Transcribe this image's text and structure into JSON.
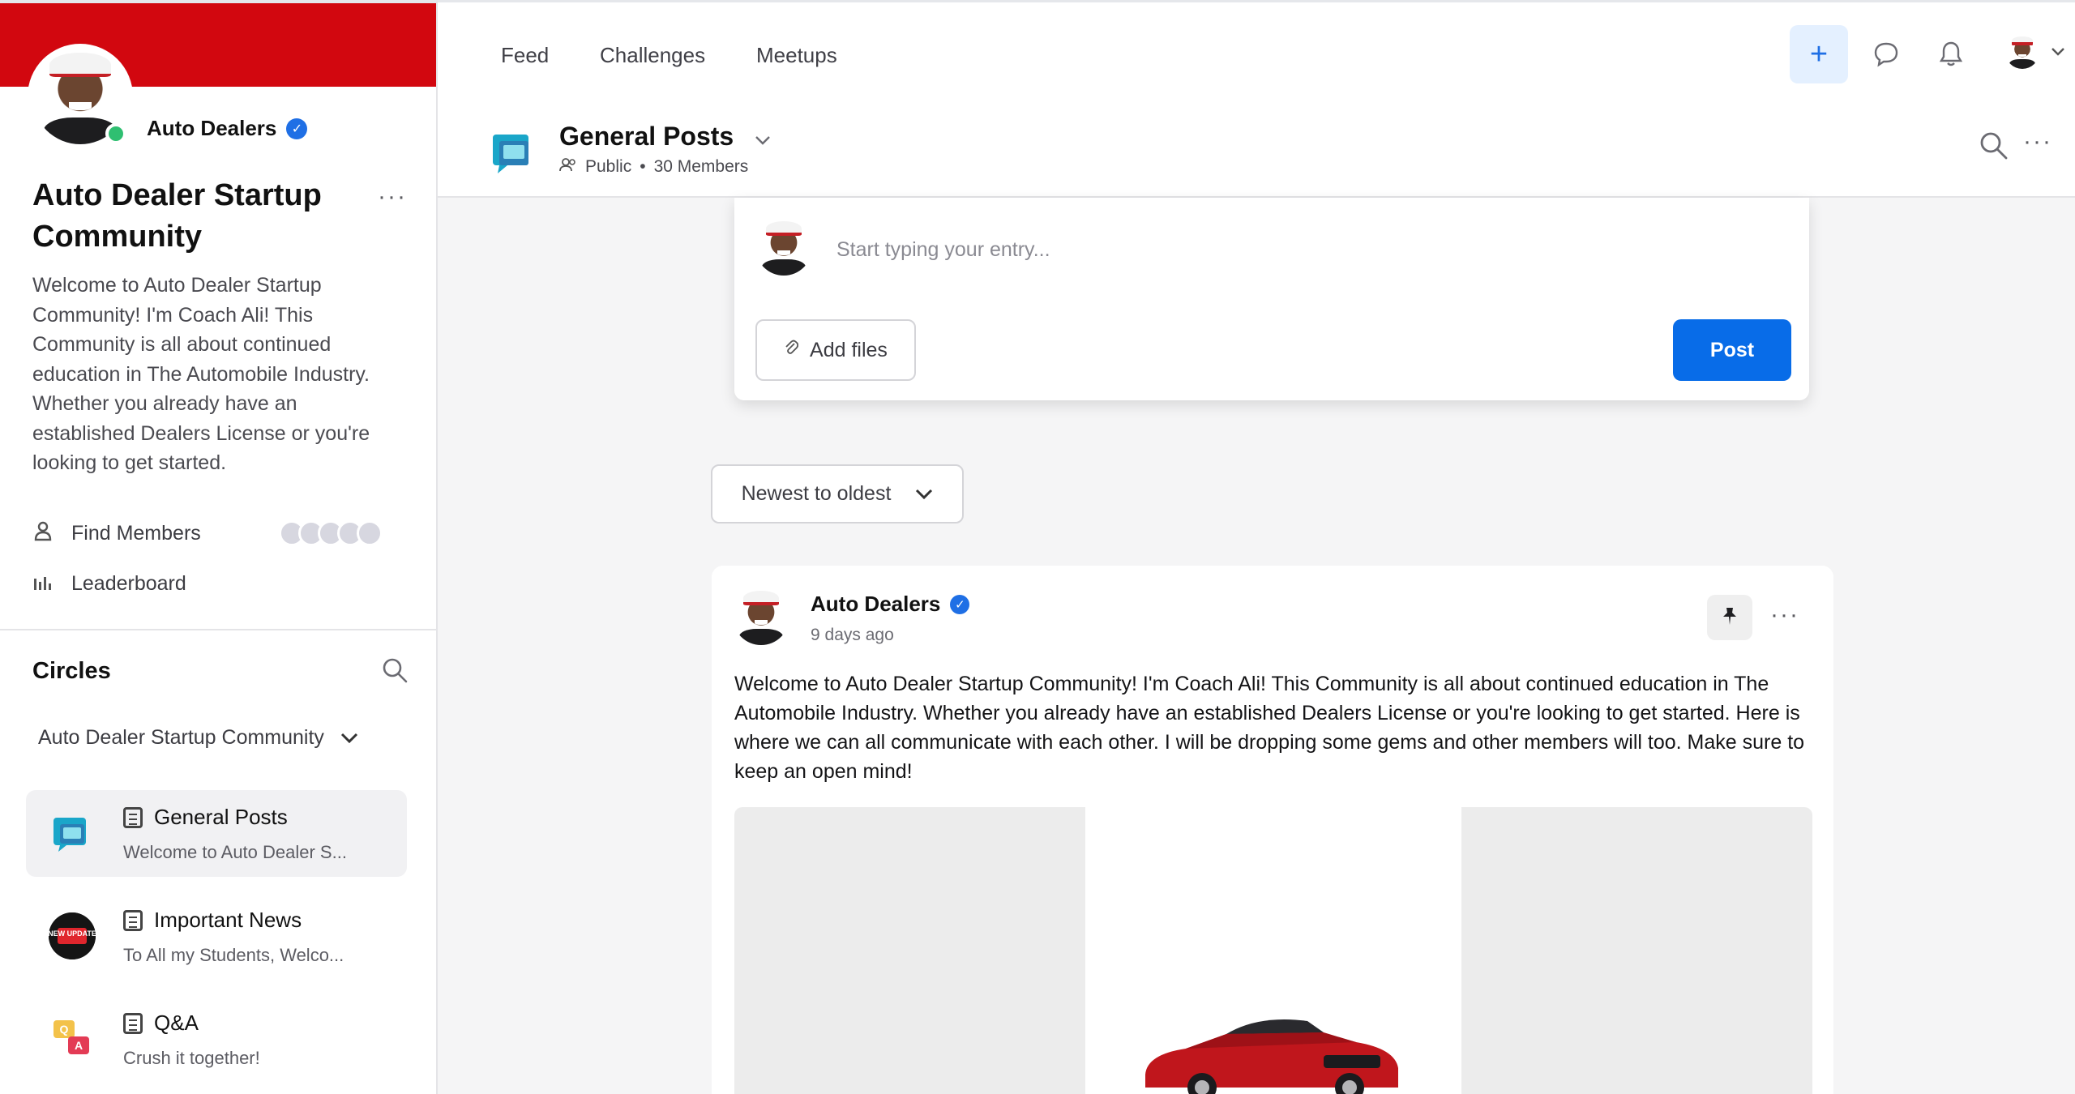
{
  "colors": {
    "banner": "#d2070f",
    "primary": "#086ce8",
    "verified": "#1f6fe5",
    "online": "#2fbf71"
  },
  "sidebar": {
    "brand_name": "Auto Dealers",
    "title": "Auto Dealer Startup Community",
    "more_label": "···",
    "description": "Welcome to Auto Dealer Startup Community! I'm Coach Ali! This Community is all about continued education in The Automobile Industry. Whether you already have an established Dealers License or you're looking to get started.",
    "links": [
      {
        "label": "Find Members",
        "icon": "user-icon"
      },
      {
        "label": "Leaderboard",
        "icon": "bar-chart-icon"
      }
    ],
    "circles_title": "Circles",
    "circles_select": "Auto Dealer Startup Community",
    "spaces": [
      {
        "name": "General Posts",
        "preview": "Welcome to Auto Dealer S...",
        "icon": "chat-bubbles-icon"
      },
      {
        "name": "Important News",
        "preview": "To All my Students, Welco...",
        "icon": "new-update-badge-icon",
        "badge_text": "NEW UPDATE"
      },
      {
        "name": "Q&A",
        "preview": "Crush it together!",
        "icon": "qa-bubbles-icon"
      }
    ]
  },
  "topnav": {
    "tabs": [
      "Feed",
      "Challenges",
      "Meetups"
    ],
    "plus_label": "+"
  },
  "space_header": {
    "title": "General Posts",
    "visibility": "Public",
    "separator": "•",
    "members": "30 Members"
  },
  "composer": {
    "placeholder": "Start typing your entry...",
    "add_files_label": "Add files",
    "post_label": "Post"
  },
  "sort": {
    "selected": "Newest to oldest"
  },
  "post": {
    "author": "Auto Dealers",
    "time": "9 days ago",
    "body": "Welcome to Auto Dealer Startup Community! I'm Coach Ali! This Community is all about continued education in The Automobile Industry. Whether you already have an established Dealers License or you're looking to get started. Here is where we can all communicate with each other. I will be dropping some gems and other members will too. Make sure to keep an open mind!",
    "more_label": "···"
  }
}
